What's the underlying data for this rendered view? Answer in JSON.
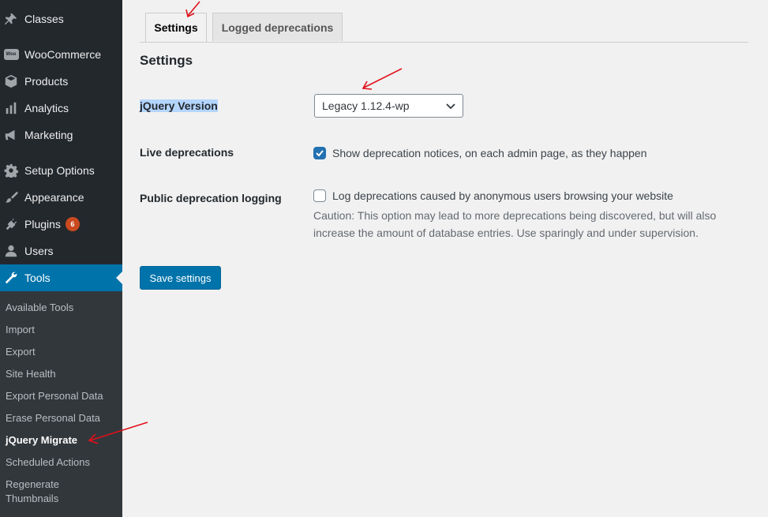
{
  "sidebar": {
    "items": [
      {
        "label": "Classes",
        "icon": "pin-icon"
      },
      {
        "label": "WooCommerce",
        "icon": "woo-icon"
      },
      {
        "label": "Products",
        "icon": "box-icon"
      },
      {
        "label": "Analytics",
        "icon": "bar-chart-icon"
      },
      {
        "label": "Marketing",
        "icon": "megaphone-icon"
      },
      {
        "label": "Setup Options",
        "icon": "gear-icon"
      },
      {
        "label": "Appearance",
        "icon": "brush-icon"
      },
      {
        "label": "Plugins",
        "icon": "plug-icon",
        "badge": "6"
      },
      {
        "label": "Users",
        "icon": "user-icon"
      },
      {
        "label": "Tools",
        "icon": "wrench-icon"
      }
    ],
    "woo_logo_text": "Woo",
    "submenu": [
      "Available Tools",
      "Import",
      "Export",
      "Site Health",
      "Export Personal Data",
      "Erase Personal Data",
      "jQuery Migrate",
      "Scheduled Actions",
      "Regenerate",
      "Thumbnails"
    ]
  },
  "tabs": {
    "settings": "Settings",
    "logged": "Logged deprecations"
  },
  "page_title": "Settings",
  "form": {
    "jquery_version_label": "jQuery Version",
    "jquery_version_value": "Legacy 1.12.4-wp",
    "live_label": "Live deprecations",
    "live_checkbox_text": "Show deprecation notices, on each admin page, as they happen",
    "public_label": "Public deprecation logging",
    "public_checkbox_text": "Log deprecations caused by anonymous users browsing your website",
    "caution_line1": "Caution: This option may lead to more deprecations being discovered, but will also",
    "caution_line2": "increase the amount of database entries. Use sparingly and under supervision."
  },
  "save_button": "Save settings",
  "colors": {
    "sidebar": "#23282d",
    "submenu": "#32373c",
    "accent": "#0073aa",
    "badge": "#ca4a1f",
    "annotation": "#e0101a"
  }
}
